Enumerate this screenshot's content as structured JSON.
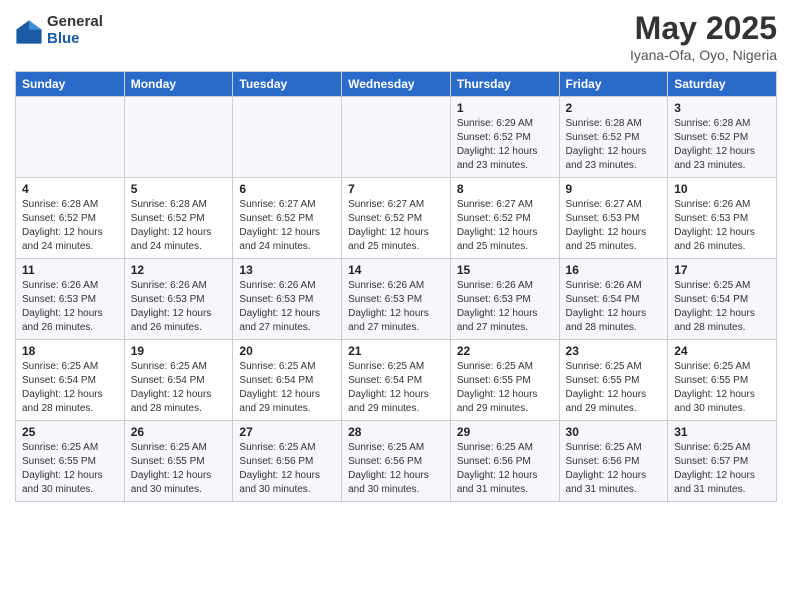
{
  "logo": {
    "general": "General",
    "blue": "Blue"
  },
  "title": "May 2025",
  "subtitle": "Iyana-Ofa, Oyo, Nigeria",
  "days_of_week": [
    "Sunday",
    "Monday",
    "Tuesday",
    "Wednesday",
    "Thursday",
    "Friday",
    "Saturday"
  ],
  "weeks": [
    [
      {
        "day": "",
        "info": ""
      },
      {
        "day": "",
        "info": ""
      },
      {
        "day": "",
        "info": ""
      },
      {
        "day": "",
        "info": ""
      },
      {
        "day": "1",
        "info": "Sunrise: 6:29 AM\nSunset: 6:52 PM\nDaylight: 12 hours and 23 minutes."
      },
      {
        "day": "2",
        "info": "Sunrise: 6:28 AM\nSunset: 6:52 PM\nDaylight: 12 hours and 23 minutes."
      },
      {
        "day": "3",
        "info": "Sunrise: 6:28 AM\nSunset: 6:52 PM\nDaylight: 12 hours and 23 minutes."
      }
    ],
    [
      {
        "day": "4",
        "info": "Sunrise: 6:28 AM\nSunset: 6:52 PM\nDaylight: 12 hours and 24 minutes."
      },
      {
        "day": "5",
        "info": "Sunrise: 6:28 AM\nSunset: 6:52 PM\nDaylight: 12 hours and 24 minutes."
      },
      {
        "day": "6",
        "info": "Sunrise: 6:27 AM\nSunset: 6:52 PM\nDaylight: 12 hours and 24 minutes."
      },
      {
        "day": "7",
        "info": "Sunrise: 6:27 AM\nSunset: 6:52 PM\nDaylight: 12 hours and 25 minutes."
      },
      {
        "day": "8",
        "info": "Sunrise: 6:27 AM\nSunset: 6:52 PM\nDaylight: 12 hours and 25 minutes."
      },
      {
        "day": "9",
        "info": "Sunrise: 6:27 AM\nSunset: 6:53 PM\nDaylight: 12 hours and 25 minutes."
      },
      {
        "day": "10",
        "info": "Sunrise: 6:26 AM\nSunset: 6:53 PM\nDaylight: 12 hours and 26 minutes."
      }
    ],
    [
      {
        "day": "11",
        "info": "Sunrise: 6:26 AM\nSunset: 6:53 PM\nDaylight: 12 hours and 26 minutes."
      },
      {
        "day": "12",
        "info": "Sunrise: 6:26 AM\nSunset: 6:53 PM\nDaylight: 12 hours and 26 minutes."
      },
      {
        "day": "13",
        "info": "Sunrise: 6:26 AM\nSunset: 6:53 PM\nDaylight: 12 hours and 27 minutes."
      },
      {
        "day": "14",
        "info": "Sunrise: 6:26 AM\nSunset: 6:53 PM\nDaylight: 12 hours and 27 minutes."
      },
      {
        "day": "15",
        "info": "Sunrise: 6:26 AM\nSunset: 6:53 PM\nDaylight: 12 hours and 27 minutes."
      },
      {
        "day": "16",
        "info": "Sunrise: 6:26 AM\nSunset: 6:54 PM\nDaylight: 12 hours and 28 minutes."
      },
      {
        "day": "17",
        "info": "Sunrise: 6:25 AM\nSunset: 6:54 PM\nDaylight: 12 hours and 28 minutes."
      }
    ],
    [
      {
        "day": "18",
        "info": "Sunrise: 6:25 AM\nSunset: 6:54 PM\nDaylight: 12 hours and 28 minutes."
      },
      {
        "day": "19",
        "info": "Sunrise: 6:25 AM\nSunset: 6:54 PM\nDaylight: 12 hours and 28 minutes."
      },
      {
        "day": "20",
        "info": "Sunrise: 6:25 AM\nSunset: 6:54 PM\nDaylight: 12 hours and 29 minutes."
      },
      {
        "day": "21",
        "info": "Sunrise: 6:25 AM\nSunset: 6:54 PM\nDaylight: 12 hours and 29 minutes."
      },
      {
        "day": "22",
        "info": "Sunrise: 6:25 AM\nSunset: 6:55 PM\nDaylight: 12 hours and 29 minutes."
      },
      {
        "day": "23",
        "info": "Sunrise: 6:25 AM\nSunset: 6:55 PM\nDaylight: 12 hours and 29 minutes."
      },
      {
        "day": "24",
        "info": "Sunrise: 6:25 AM\nSunset: 6:55 PM\nDaylight: 12 hours and 30 minutes."
      }
    ],
    [
      {
        "day": "25",
        "info": "Sunrise: 6:25 AM\nSunset: 6:55 PM\nDaylight: 12 hours and 30 minutes."
      },
      {
        "day": "26",
        "info": "Sunrise: 6:25 AM\nSunset: 6:55 PM\nDaylight: 12 hours and 30 minutes."
      },
      {
        "day": "27",
        "info": "Sunrise: 6:25 AM\nSunset: 6:56 PM\nDaylight: 12 hours and 30 minutes."
      },
      {
        "day": "28",
        "info": "Sunrise: 6:25 AM\nSunset: 6:56 PM\nDaylight: 12 hours and 30 minutes."
      },
      {
        "day": "29",
        "info": "Sunrise: 6:25 AM\nSunset: 6:56 PM\nDaylight: 12 hours and 31 minutes."
      },
      {
        "day": "30",
        "info": "Sunrise: 6:25 AM\nSunset: 6:56 PM\nDaylight: 12 hours and 31 minutes."
      },
      {
        "day": "31",
        "info": "Sunrise: 6:25 AM\nSunset: 6:57 PM\nDaylight: 12 hours and 31 minutes."
      }
    ]
  ]
}
